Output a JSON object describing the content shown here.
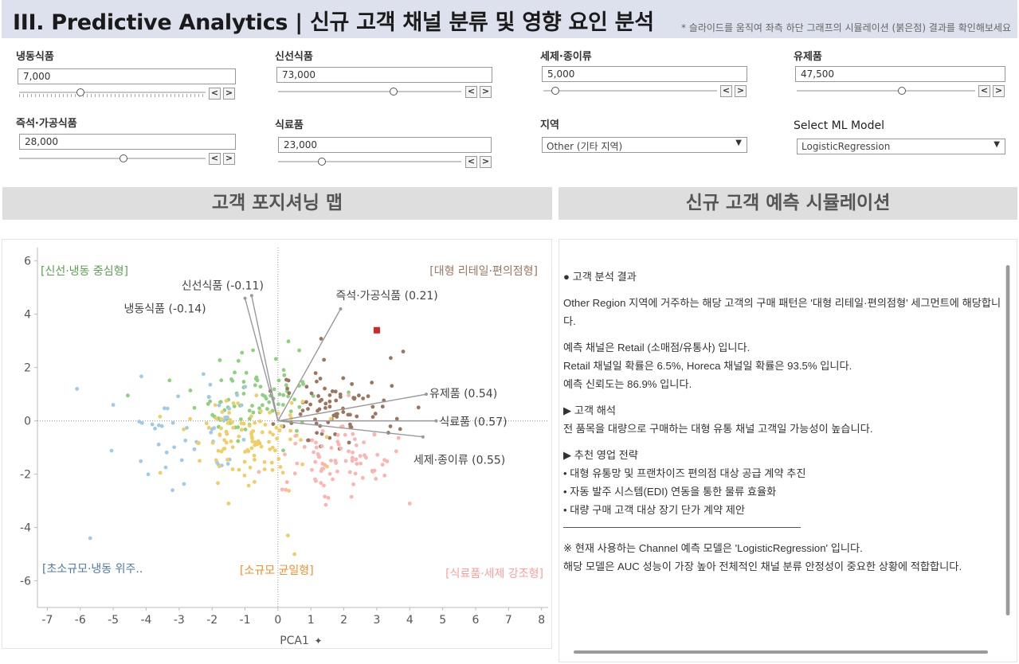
{
  "header": {
    "title": "III. Predictive Analytics | 신규 고객 채널 분류 및 영향 요인 분석",
    "note": "* 슬라이드를 움직여 좌측 하단 그래프의 시뮬레이션 (붉은점) 결과를 확인해보세요"
  },
  "controls": {
    "frozen": {
      "label": "냉동식품",
      "value": "7,000",
      "level": 0.33
    },
    "fresh": {
      "label": "신선식품",
      "value": "73,000",
      "level": 0.63
    },
    "detergent": {
      "label": "세제·종이류",
      "value": "5,000",
      "level": 0.07
    },
    "milk": {
      "label": "유제품",
      "value": "47,500",
      "level": 0.59
    },
    "delicatessen": {
      "label": "즉석·가공식품",
      "value": "28,000",
      "level": 0.56
    },
    "grocery": {
      "label": "식료품",
      "value": "23,000",
      "level": 0.24
    },
    "step_prev": "<",
    "step_next": ">"
  },
  "region": {
    "label": "지역",
    "value": "Other (기타 지역)"
  },
  "model": {
    "label": "Select ML Model",
    "value": "LogisticRegression"
  },
  "sections": {
    "map_title": "고객 포지셔닝 맵",
    "sim_title": "신규 고객 예측 시뮬레이션"
  },
  "chart_data": {
    "type": "scatter",
    "xlabel": "PCA1",
    "xlim": [
      -7.3,
      8.2
    ],
    "ylim": [
      -7,
      6.5
    ],
    "xticks": [
      -7,
      -6,
      -5,
      -4,
      -3,
      -2,
      -1,
      0,
      1,
      2,
      3,
      4,
      5,
      6,
      7,
      8
    ],
    "yticks": [
      6,
      4,
      2,
      0,
      -2,
      -4,
      -6
    ],
    "quadrant_labels": [
      {
        "text": "[신선·냉동 중심형]",
        "color": "#59a14f"
      },
      {
        "text": "[대형 리테일·편의점형]",
        "color": "#9c755f"
      },
      {
        "text": "[초소규모·냉동 위주..",
        "color": "#4e79a7"
      },
      {
        "text": "[소규모 균일형]",
        "color": "#f28e2b"
      },
      {
        "text": "[식료품·세제 강조형]",
        "color": "#ff9d9a"
      }
    ],
    "loadings": [
      {
        "name": "냉동식품 (-0.14)",
        "x": -1.0,
        "y": 4.6
      },
      {
        "name": "신선식품 (-0.11)",
        "x": -0.8,
        "y": 4.7
      },
      {
        "name": "즉석·가공식품 (0.21)",
        "x": 1.9,
        "y": 4.2
      },
      {
        "name": "유제품 (0.54)",
        "x": 4.5,
        "y": 1.0
      },
      {
        "name": "식료품 (0.57)",
        "x": 4.8,
        "y": 0.0
      },
      {
        "name": "세제·종이류 (0.55)",
        "x": 4.4,
        "y": -0.6
      }
    ],
    "series": [
      {
        "cluster": "신선·냉동 중심형",
        "color": "#8cd17d",
        "center": [
          -0.6,
          1.0
        ],
        "spread": [
          1.0,
          0.75
        ],
        "n": 85
      },
      {
        "cluster": "대형 리테일·편의점형",
        "color": "#9c755f",
        "center": [
          1.6,
          0.5
        ],
        "spread": [
          1.0,
          0.85
        ],
        "n": 85
      },
      {
        "cluster": "초소규모·냉동 위주",
        "color": "#a0cbe8",
        "center": [
          -2.6,
          -0.6
        ],
        "spread": [
          1.1,
          0.9
        ],
        "n": 45
      },
      {
        "cluster": "소규모 균일형",
        "color": "#f1ce63",
        "center": [
          -0.9,
          -0.8
        ],
        "spread": [
          0.95,
          0.85
        ],
        "n": 110
      },
      {
        "cluster": "식료품·세제 강조형",
        "color": "#ffb3b0",
        "center": [
          1.8,
          -1.6
        ],
        "spread": [
          0.95,
          0.75
        ],
        "n": 80
      }
    ],
    "outliers": [
      {
        "x": -6.1,
        "y": 1.2,
        "color": "#a0cbe8"
      },
      {
        "x": -5.7,
        "y": -4.4,
        "color": "#a0cbe8"
      },
      {
        "x": -5.0,
        "y": 0.6,
        "color": "#a0cbe8"
      },
      {
        "x": -3.2,
        "y": -2.6,
        "color": "#a0cbe8"
      },
      {
        "x": 0.5,
        "y": -5.0,
        "color": "#f1ce63"
      },
      {
        "x": 0.3,
        "y": -4.3,
        "color": "#f1ce63"
      },
      {
        "x": 3.8,
        "y": 2.6,
        "color": "#9c755f"
      },
      {
        "x": 4.0,
        "y": -3.1,
        "color": "#ffb3b0"
      },
      {
        "x": -1.5,
        "y": -3.1,
        "color": "#f1ce63"
      }
    ],
    "simulation_point": {
      "x": 3.0,
      "y": 3.4,
      "color": "#d62728"
    }
  },
  "result": {
    "heading": "● 고객 분석 결과",
    "p1": "Other Region 지역에 거주하는 해당 고객의 구매 패턴은 '대형 리테일·편의점형' 세그먼트에 해당합니다.",
    "p2a": "예측 채널은 Retail (소매점/유통사) 입니다.",
    "p2b": "Retail 채널일 확률은 6.5%, Horeca 채널일 확률은 93.5% 입니다.",
    "p2c": "예측 신뢰도는 86.9% 입니다.",
    "interp_heading": "▶ 고객 해석",
    "interp": "전 품목을 대량으로 구매하는 대형 유통 채널 고객일 가능성이 높습니다.",
    "strategy_heading": "▶ 추천 영업 전략",
    "s1": "• 대형 유통망 및 프랜차이즈 편의점 대상 공급 계약 추진",
    "s2": "• 자동 발주 시스템(EDI) 연동을 통한 물류 효율화",
    "s3": "• 대량 구매 고객 대상 장기 단가 계약 제안",
    "footnote1": "※ 현재 사용하는 Channel 예측 모델은 'LogisticRegression' 입니다.",
    "footnote2": "해당 모델은 AUC 성능이 가장 높아 전체적인 채널 분류 안정성이 중요한 상황에 적합합니다."
  }
}
